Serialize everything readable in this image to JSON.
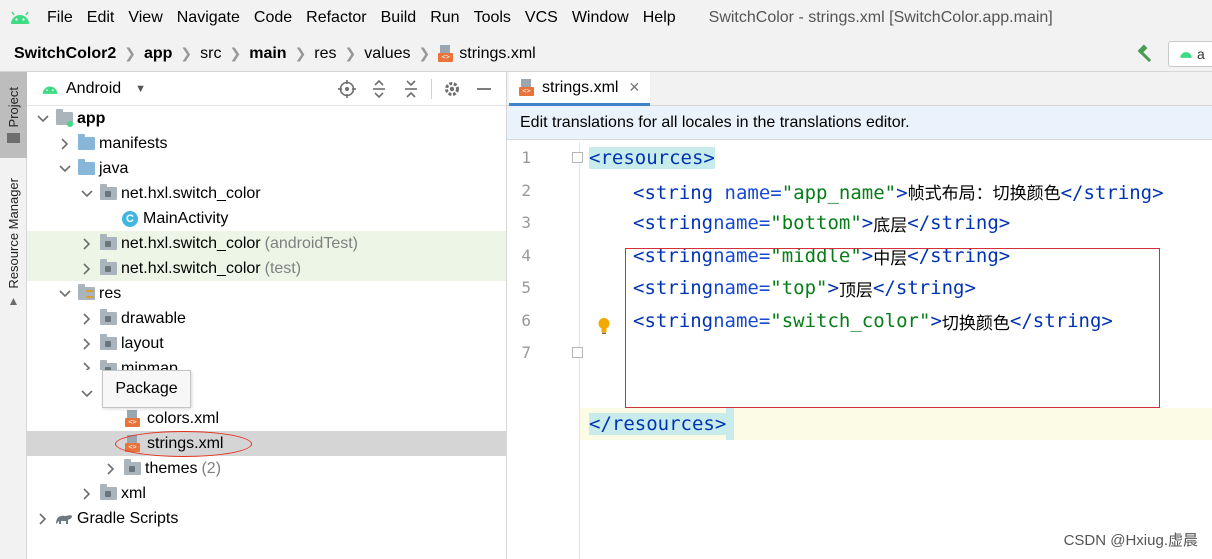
{
  "menubar": {
    "logo_icon": "android-icon",
    "items": [
      "File",
      "Edit",
      "View",
      "Navigate",
      "Code",
      "Refactor",
      "Build",
      "Run",
      "Tools",
      "VCS",
      "Window",
      "Help"
    ],
    "window_title": "SwitchColor - strings.xml [SwitchColor.app.main]"
  },
  "breadcrumb": {
    "items": [
      "SwitchColor2",
      "app",
      "src",
      "main",
      "res",
      "values",
      "strings.xml"
    ],
    "run_config": "a"
  },
  "toolstrip": {
    "project_tab": "Project",
    "resource_manager_tab": "Resource Manager"
  },
  "project": {
    "view_label": "Android",
    "tree": [
      {
        "label": "app",
        "suffix": "",
        "icon": "module-folder-icon"
      },
      {
        "label": "manifests",
        "suffix": "",
        "icon": "folder-icon"
      },
      {
        "label": "java",
        "suffix": "",
        "icon": "folder-icon"
      },
      {
        "label": "net.hxl.switch_color",
        "suffix": "",
        "icon": "package-icon"
      },
      {
        "label": "MainActivity",
        "suffix": "",
        "icon": "class-icon"
      },
      {
        "label": "net.hxl.switch_color",
        "suffix": "(androidTest)",
        "icon": "package-icon"
      },
      {
        "label": "net.hxl.switch_color",
        "suffix": "(test)",
        "icon": "package-icon"
      },
      {
        "label": "res",
        "suffix": "",
        "icon": "res-folder-icon"
      },
      {
        "label": "drawable",
        "suffix": "",
        "icon": "package-icon"
      },
      {
        "label": "layout",
        "suffix": "",
        "icon": "package-icon"
      },
      {
        "label": "mipmap",
        "suffix": "",
        "icon": "package-icon"
      },
      {
        "label": "",
        "suffix": "",
        "icon": "package-icon"
      },
      {
        "label": "colors.xml",
        "suffix": "",
        "icon": "xml-file-icon"
      },
      {
        "label": "strings.xml",
        "suffix": "",
        "icon": "xml-file-icon"
      },
      {
        "label": "themes",
        "suffix": "(2)",
        "icon": "package-icon"
      },
      {
        "label": "xml",
        "suffix": "",
        "icon": "package-icon"
      },
      {
        "label": "Gradle Scripts",
        "suffix": "",
        "icon": "gradle-icon"
      }
    ],
    "tooltip": "Package"
  },
  "editor": {
    "tab_label": "strings.xml",
    "notice": "Edit translations for all locales in the translations editor.",
    "line_numbers": [
      "1",
      "2",
      "3",
      "4",
      "5",
      "6",
      "7"
    ],
    "lines": {
      "l1_open": "<resources>",
      "s_open": "<string",
      "name_attr": "name=",
      "s_close": "</string>",
      "l2_name": "\"app_name\"",
      "l2_text": "帧式布局：切换颜色",
      "l3_name": "\"bottom\"",
      "l3_text": "底层",
      "l4_name": "\"middle\"",
      "l4_text": "中层",
      "l5_name": "\"top\"",
      "l5_text": "顶层",
      "l6_name": "\"switch_color\"",
      "l6_text": "切换颜色",
      "l7_close": "</resources>"
    }
  },
  "watermark": "CSDN @Hxiug.虚晨",
  "colors": {
    "accent": "#4083c9",
    "selection": "#d5d5d5",
    "annotation_red": "#d2303a",
    "xml_tag": "#0033b3",
    "xml_value": "#067d17"
  }
}
